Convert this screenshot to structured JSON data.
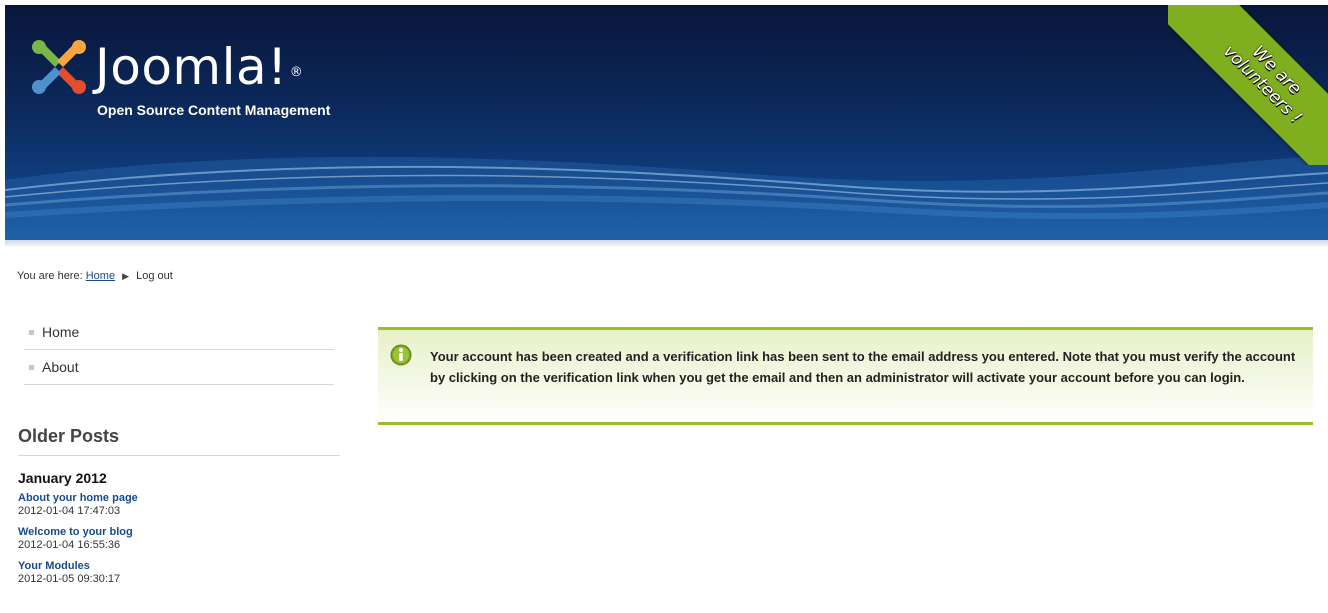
{
  "header": {
    "logo_text": "Joomla!",
    "logo_registered": "®",
    "tagline": "Open Source Content Management",
    "ribbon_line1": "We are",
    "ribbon_line2": "volunteers !",
    "colors": {
      "ribbon": "#7fae1e",
      "header_dark": "#09163a",
      "header_light": "#1b5ca3"
    }
  },
  "breadcrumb": {
    "prefix": "You are here:",
    "home_label": "Home",
    "separator": "▶",
    "current": "Log out"
  },
  "nav": {
    "items": [
      {
        "label": "Home"
      },
      {
        "label": "About"
      }
    ]
  },
  "older_posts": {
    "title": "Older Posts",
    "month": "January 2012",
    "posts": [
      {
        "title": "About your home page",
        "date": "2012-01-04 17:47:03"
      },
      {
        "title": "Welcome to your blog",
        "date": "2012-01-04 16:55:36"
      },
      {
        "title": "Your Modules",
        "date": "2012-01-05 09:30:17"
      }
    ]
  },
  "message": {
    "icon": "info-icon",
    "text": "Your account has been created and a verification link has been sent to the email address you entered. Note that you must verify the account by clicking on the verification link when you get the email and then an administrator will activate your account before you can login.",
    "accent_color": "#9bbc2c"
  }
}
